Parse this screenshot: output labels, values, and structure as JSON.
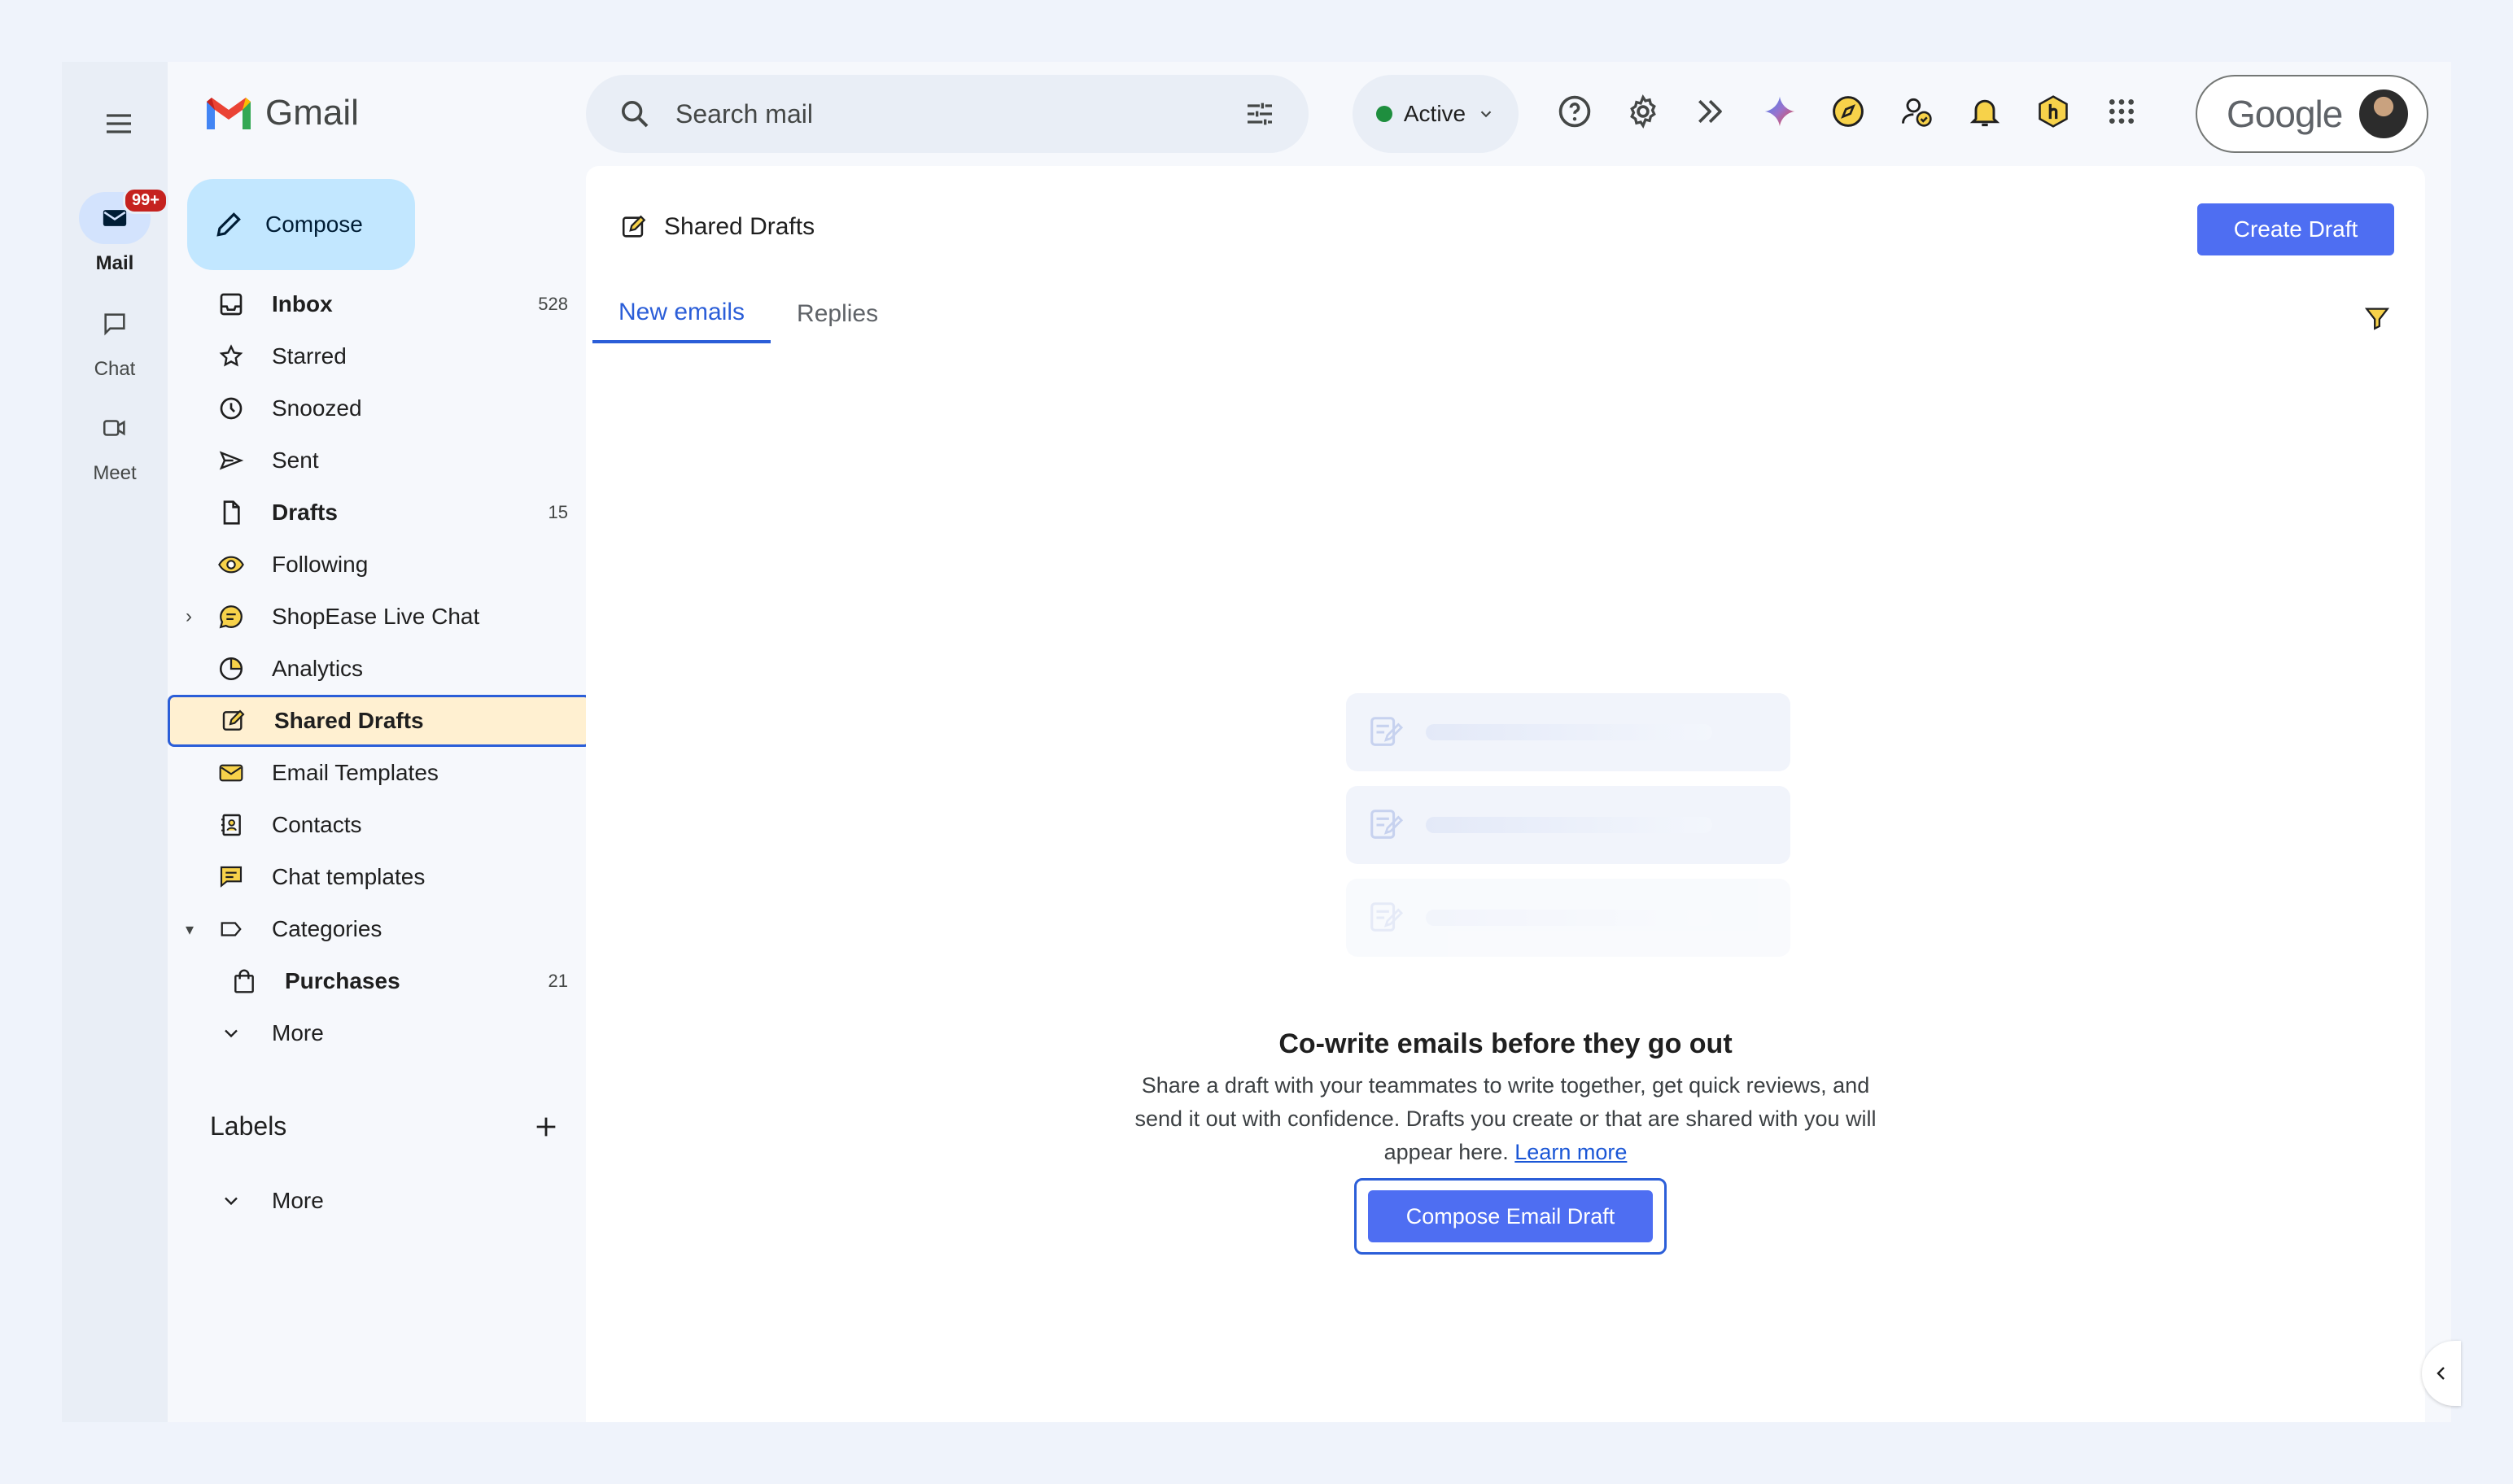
{
  "rail": {
    "items": [
      {
        "label": "Mail",
        "badge": "99+"
      },
      {
        "label": "Chat"
      },
      {
        "label": "Meet"
      }
    ]
  },
  "app": {
    "name": "Gmail"
  },
  "compose": {
    "label": "Compose"
  },
  "nav": {
    "inbox": {
      "label": "Inbox",
      "count": "528"
    },
    "starred": {
      "label": "Starred"
    },
    "snoozed": {
      "label": "Snoozed"
    },
    "sent": {
      "label": "Sent"
    },
    "drafts": {
      "label": "Drafts",
      "count": "15"
    },
    "following": {
      "label": "Following"
    },
    "shopease": {
      "label": "ShopEase Live Chat"
    },
    "analytics": {
      "label": "Analytics"
    },
    "shared_drafts": {
      "label": "Shared Drafts"
    },
    "email_templates": {
      "label": "Email Templates"
    },
    "contacts": {
      "label": "Contacts"
    },
    "chat_templates": {
      "label": "Chat templates"
    },
    "categories": {
      "label": "Categories"
    },
    "purchases": {
      "label": "Purchases",
      "count": "21"
    },
    "more": {
      "label": "More"
    }
  },
  "labels": {
    "title": "Labels",
    "more": "More"
  },
  "search": {
    "placeholder": "Search mail"
  },
  "status": {
    "label": "Active",
    "color": "#1e8e3e"
  },
  "account": {
    "brand": "Google"
  },
  "main": {
    "title": "Shared Drafts",
    "create_button": "Create Draft",
    "tabs": [
      "New emails",
      "Replies"
    ],
    "empty": {
      "title": "Co-write emails before they go out",
      "desc": "Share a draft with your teammates to write together, get quick reviews, and send it out with confidence. Drafts you create or that are shared with you will appear here.",
      "link": "Learn more",
      "cta": "Compose Email Draft"
    }
  },
  "colors": {
    "accent": "#4e6ef2",
    "selected_bg": "#fff0d1",
    "selected_border": "#2b5ed8"
  }
}
